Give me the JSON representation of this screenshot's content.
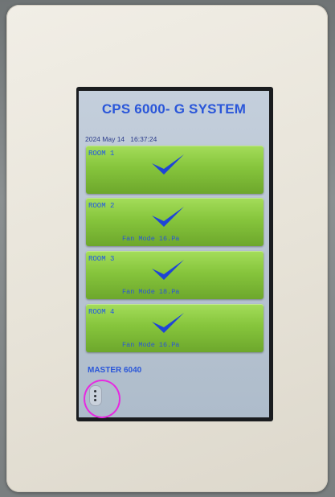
{
  "screen": {
    "title": "CPS 6000- G SYSTEM",
    "date": "2024 May 14",
    "time": "16:37:24"
  },
  "rooms": [
    {
      "label": "ROOM 1",
      "status": "",
      "icon": "check-icon"
    },
    {
      "label": "ROOM 2",
      "status": "Fan Mode 16.Pa",
      "icon": "check-icon"
    },
    {
      "label": "ROOM 3",
      "status": "Fan Mode 18.Pa",
      "icon": "check-icon"
    },
    {
      "label": "ROOM 4",
      "status": "Fan Mode 16.Pa",
      "icon": "check-icon"
    }
  ],
  "master": {
    "label": "MASTER 6040"
  },
  "menu_button": {
    "icon": "vertical-dots-icon"
  },
  "colors": {
    "title": "#2a56d9",
    "tile_green": "#86c53c",
    "check": "#1f45d6",
    "annotation": "#e62ae0",
    "screen_bg": "#bac6d3"
  }
}
